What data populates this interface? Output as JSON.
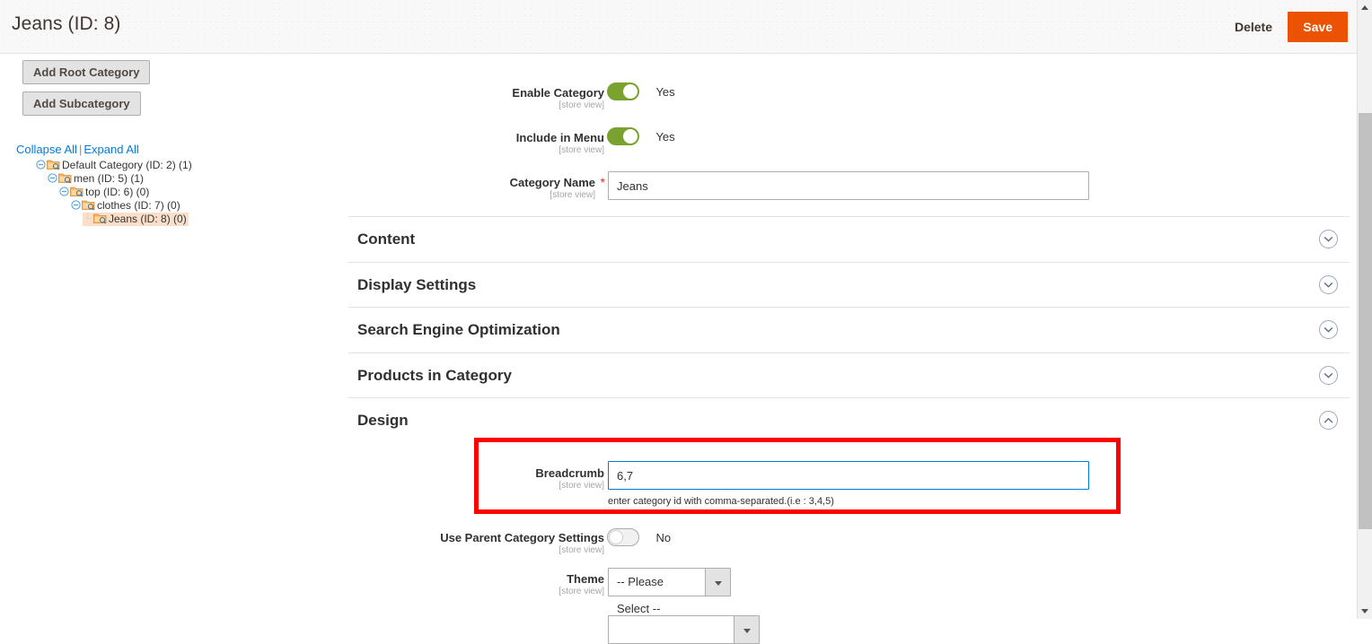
{
  "header": {
    "title": "Jeans (ID: 8)",
    "delete_label": "Delete",
    "save_label": "Save",
    "save_color": "#eb5202"
  },
  "sidebar": {
    "add_root_label": "Add Root Category",
    "add_sub_label": "Add Subcategory",
    "collapse_all_label": "Collapse All",
    "separator": "|",
    "expand_all_label": "Expand All",
    "link_color": "#007bdb",
    "selected_highlight_color": "#fbdfc9",
    "tree": [
      {
        "label": "Default Category (ID: 2) (1)",
        "depth": 0,
        "selected": false
      },
      {
        "label": "men (ID: 5) (1)",
        "depth": 1,
        "selected": false
      },
      {
        "label": "top (ID: 6) (0)",
        "depth": 2,
        "selected": false
      },
      {
        "label": "clothes (ID: 7) (0)",
        "depth": 3,
        "selected": false
      },
      {
        "label": "Jeans (ID: 8) (0)",
        "depth": 4,
        "selected": true
      }
    ]
  },
  "form": {
    "scope_note": "[store view]",
    "enable_category": {
      "label": "Enable Category",
      "value": "Yes",
      "on": true
    },
    "include_in_menu": {
      "label": "Include in Menu",
      "value": "Yes",
      "on": true
    },
    "category_name": {
      "label": "Category Name",
      "value": "Jeans",
      "required_marker": "*"
    }
  },
  "sections": [
    {
      "title": "Content",
      "expanded": false
    },
    {
      "title": "Display Settings",
      "expanded": false
    },
    {
      "title": "Search Engine Optimization",
      "expanded": false
    },
    {
      "title": "Products in Category",
      "expanded": false
    },
    {
      "title": "Design",
      "expanded": true
    }
  ],
  "design": {
    "breadcrumb": {
      "label": "Breadcrumb",
      "value": "6,7",
      "note": "enter category id with comma-separated.(i.e : 3,4,5)",
      "focused": true,
      "highlight_color": "#fe0000"
    },
    "use_parent_category_settings": {
      "label": "Use Parent Category Settings",
      "value": "No",
      "on": false
    },
    "theme": {
      "label": "Theme",
      "value": "-- Please Select --"
    }
  }
}
